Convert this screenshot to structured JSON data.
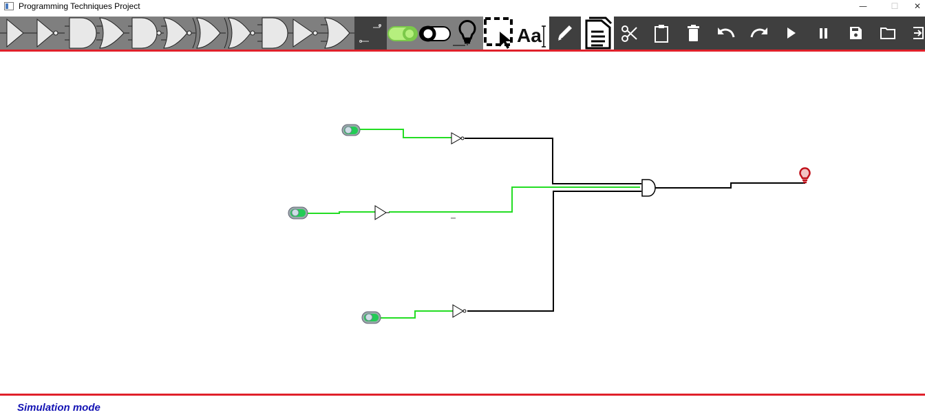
{
  "window": {
    "title": "Programming Techniques Project",
    "minimize_glyph": "—",
    "maximize_glyph": "☐",
    "close_glyph": "✕"
  },
  "toolbar": {
    "gate_tools": [
      "buffer",
      "not",
      "and",
      "or",
      "nand",
      "xor-like",
      "xor",
      "xnor",
      "and-3",
      "not-2",
      "or-3"
    ],
    "other_tools": [
      "wire-tool",
      "switch-on",
      "switch-off",
      "led",
      "select-tool",
      "text-tool",
      "edit",
      "document",
      "cut",
      "paste",
      "delete",
      "undo",
      "redo",
      "run",
      "pause",
      "save",
      "open",
      "exit"
    ],
    "text_tool_label": "Aa"
  },
  "circuit": {
    "switches": [
      "switch-1",
      "switch-2",
      "switch-3"
    ],
    "gates": [
      "not-gate-1",
      "buffer-gate",
      "not-gate-2",
      "and-gate"
    ],
    "output": "led-output",
    "active_wire_color": "#22dd22",
    "inactive_wire_color": "#000000",
    "led_color": "#c0101a"
  },
  "colors": {
    "accent_red": "#e0202a",
    "toolbar_bg": "#3f3f3f",
    "status_blue": "#1414b4"
  },
  "status": {
    "mode_text": "Simulation mode"
  }
}
